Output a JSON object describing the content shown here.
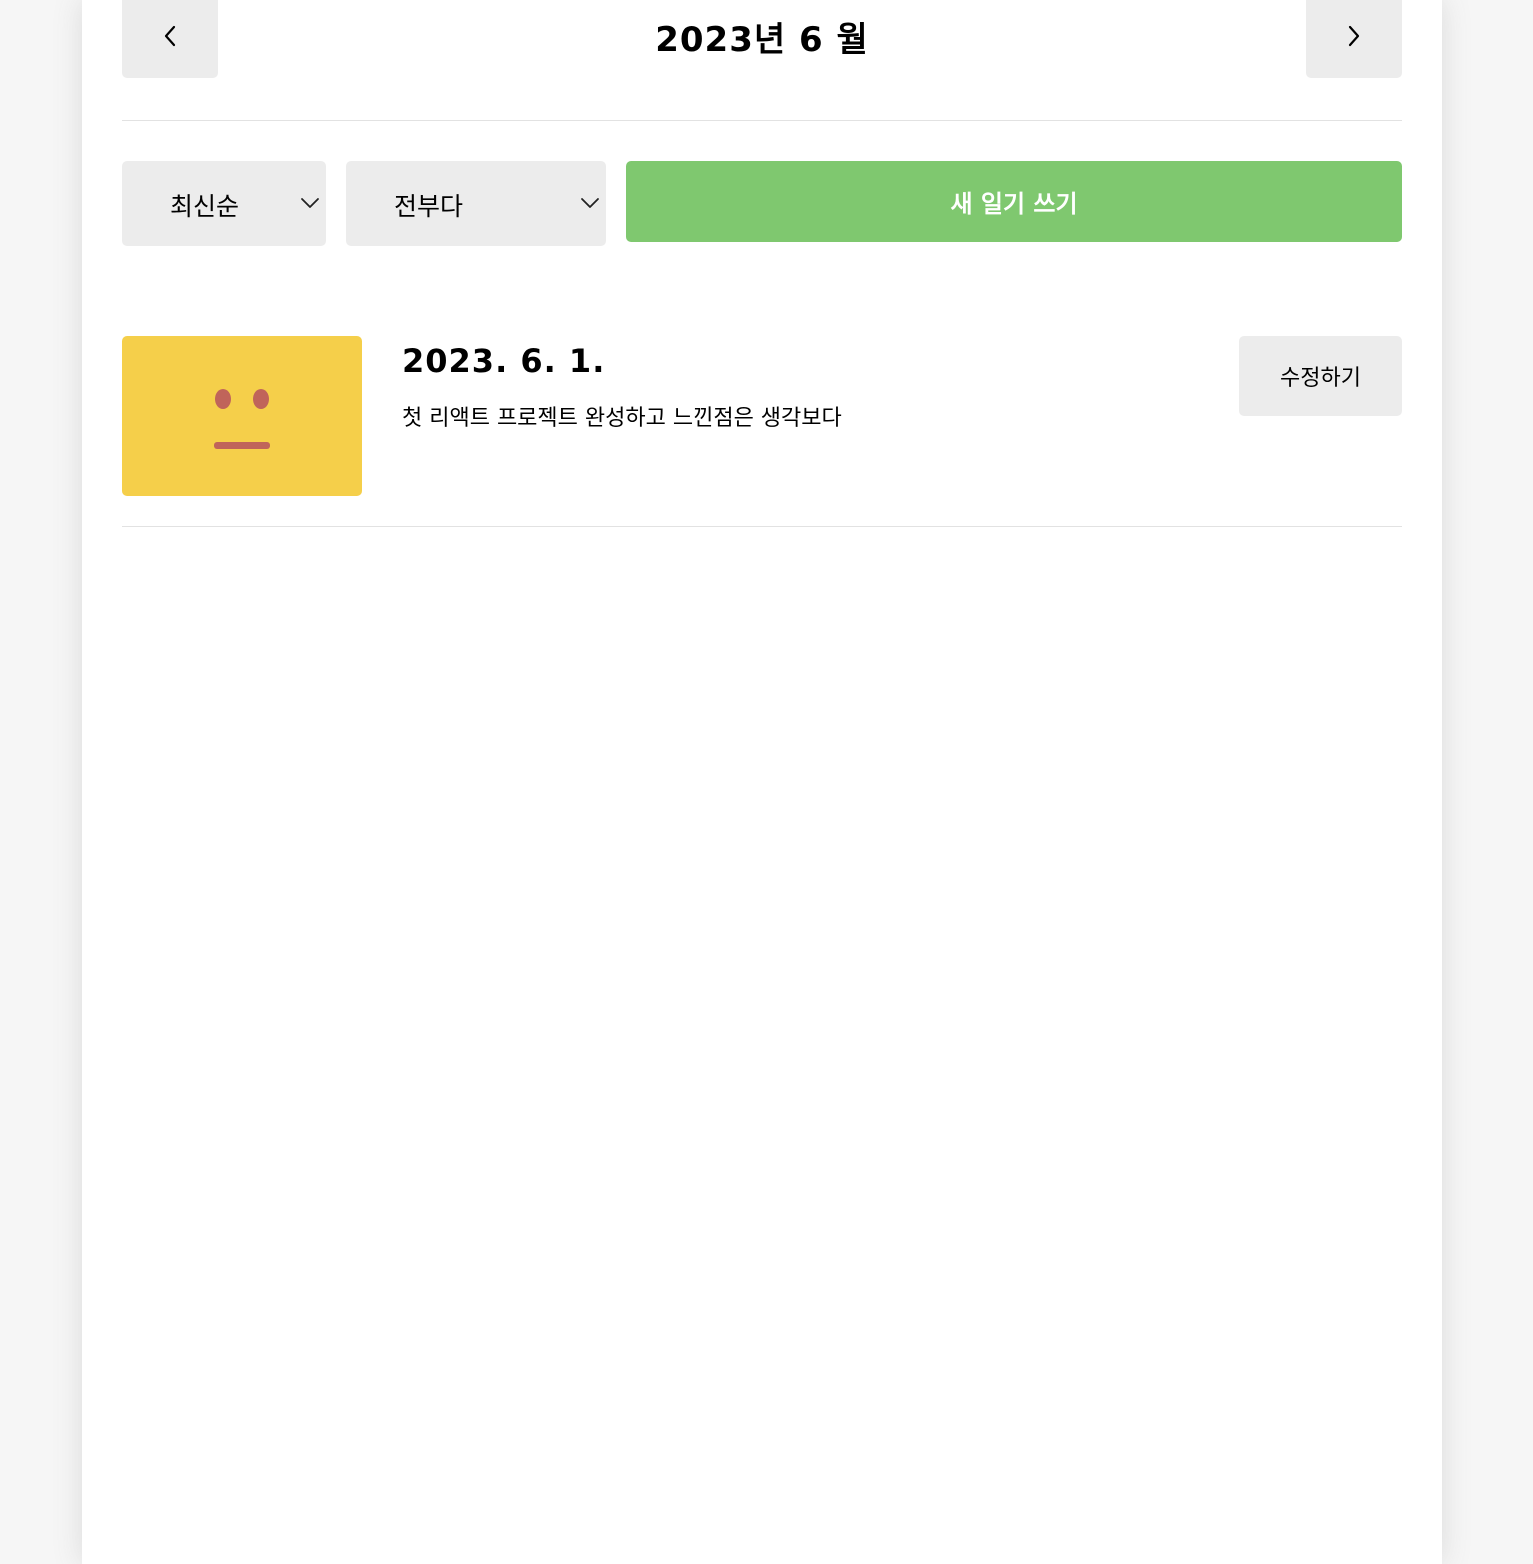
{
  "header": {
    "title": "2023년 6 월",
    "prev_icon": "chevron-left-icon",
    "next_icon": "chevron-right-icon"
  },
  "menu": {
    "sort_selected": "최신순",
    "filter_selected": "전부다",
    "new_button_label": "새 일기 쓰기",
    "new_button_color": "#7fc86f"
  },
  "diaries": [
    {
      "date": "2023. 6. 1.",
      "content": "첫 리액트 프로젝트 완성하고 느낀점은 생각보다",
      "emotion_icon": "neutral-face-icon",
      "emotion_color": "#f5cf4a",
      "edit_label": "수정하기"
    }
  ],
  "colors": {
    "page_background": "#f6f6f6",
    "button_gray": "#ececec",
    "divider": "#e2e2e2",
    "face_features": "#c0645a"
  }
}
